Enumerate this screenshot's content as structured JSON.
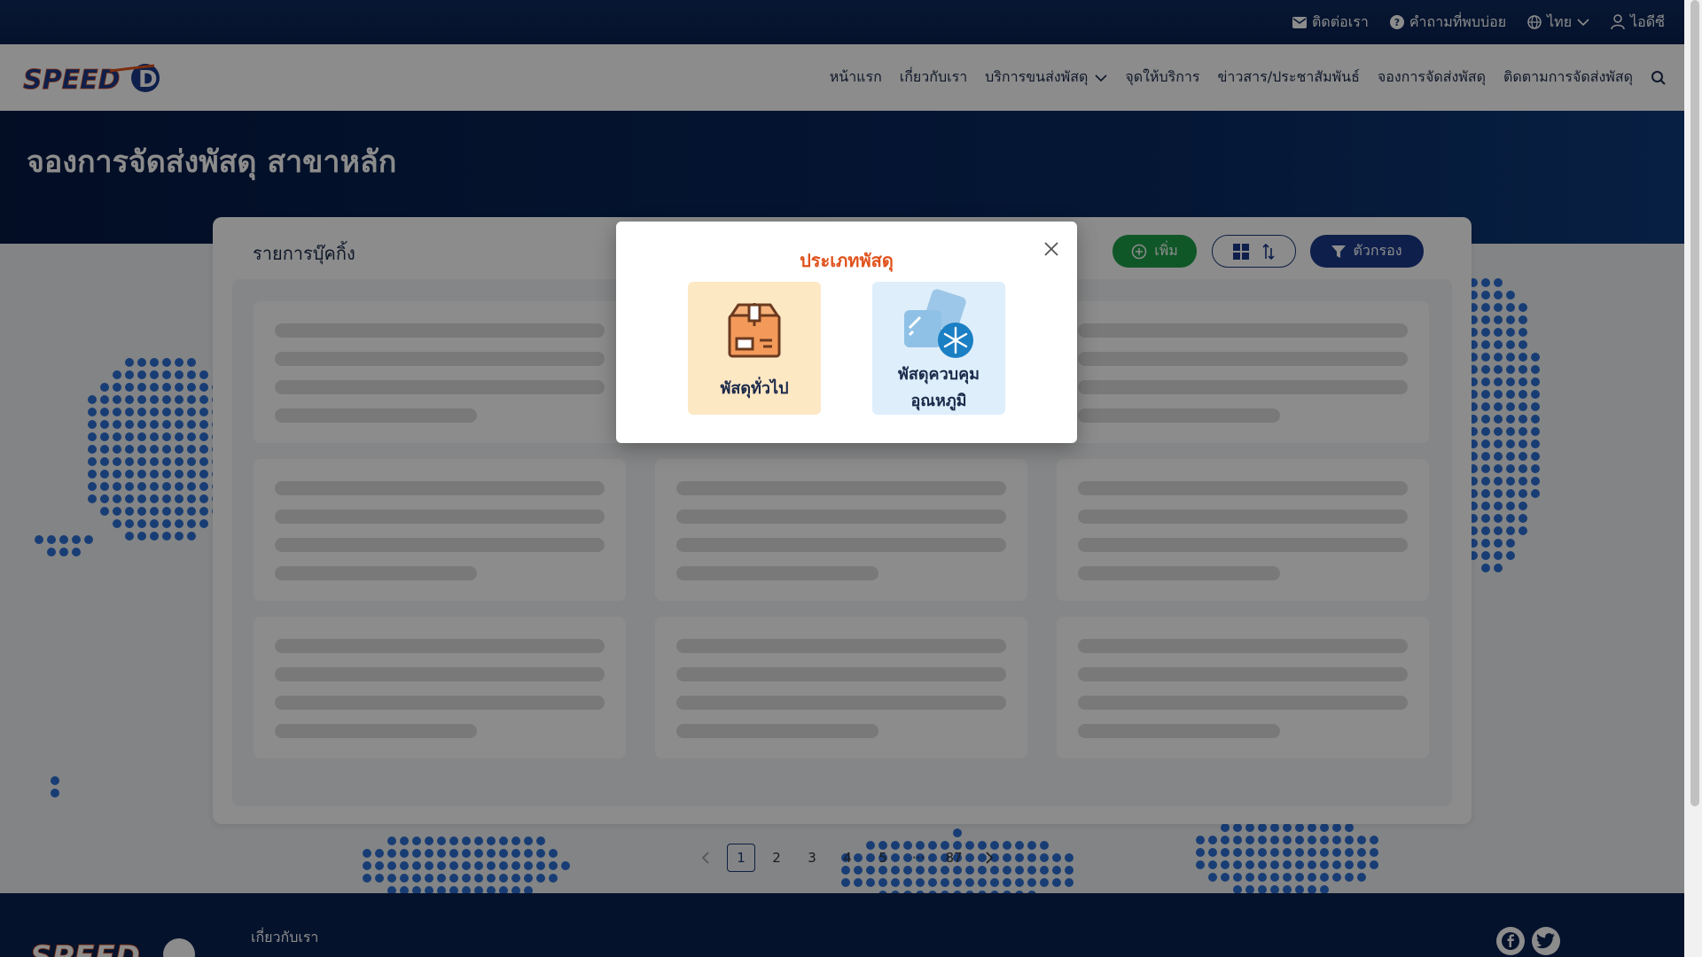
{
  "topbar": {
    "contact": "ติดต่อเรา",
    "faq": "คำถามที่พบบ่อย",
    "language": "ไทย",
    "user": "ไอดีซี"
  },
  "brand": {
    "logo_text": "SPEED-D"
  },
  "nav": {
    "items": [
      "หน้าแรก",
      "เกี่ยวกับเรา",
      "บริการขนส่งพัสดุ",
      "จุดให้บริการ",
      "ข่าวสาร/ประชาสัมพันธ์",
      "จองการจัดส่งพัสดุ",
      "ติดตามการจัดส่งพัสดุ"
    ]
  },
  "page": {
    "title": "จองการจัดส่งพัสดุ สาขาหลัก"
  },
  "panel": {
    "title": "รายการบุ๊คกิ้ง",
    "add_label": "เพิ่ม",
    "filter_label": "ตัวกรอง"
  },
  "pagination": {
    "pages": [
      "1",
      "2",
      "3",
      "4",
      "5"
    ],
    "ellipsis": "···",
    "last": "87",
    "current": "1"
  },
  "footer": {
    "about": "เกี่ยวกับเรา"
  },
  "modal": {
    "title": "ประเภทพัสดุ",
    "options": [
      {
        "label": "พัสดุทั่วไป",
        "icon": "parcel-box-icon"
      },
      {
        "label_line1": "พัสดุควบคุม",
        "label_line2": "อุณหภูมิ",
        "icon": "cold-chain-icon"
      }
    ]
  },
  "colors": {
    "primary": "#0a2150",
    "accent": "#e0521c",
    "success": "#1e9e4a"
  }
}
